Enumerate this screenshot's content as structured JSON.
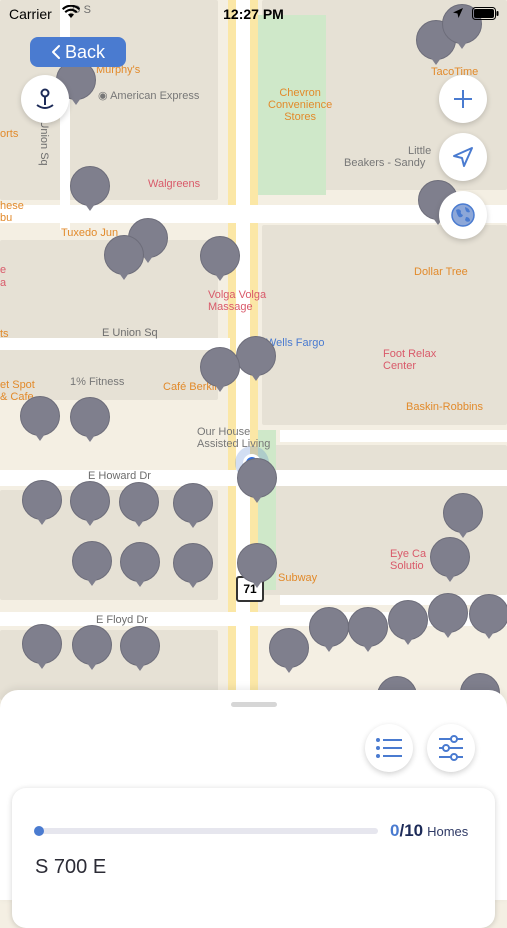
{
  "status_bar": {
    "carrier": "Carrier",
    "time": "12:27 PM"
  },
  "nav": {
    "back_label": "Back"
  },
  "map": {
    "street_labels": [
      "S Union Sq",
      "E Union Sq",
      "E Howard Dr",
      "E Floyd Dr"
    ],
    "pois": {
      "murphys": "Murphy's",
      "american_express": "American Express",
      "walgreens": "Walgreens",
      "tuxedo": "Tuxedo Jun",
      "volga": "Volga Volga\nMassage",
      "fitness": "1% Fitness",
      "cafe": "Café Berkli",
      "wells_fargo": "Wells Fargo",
      "our_house": "Our House\nAssisted Living",
      "chevron": "Chevron\nConvenience\nStores",
      "beakers": "Beakers - Sandy",
      "little": "Little",
      "tacotime": "TacoTime",
      "dollar_tree": "Dollar Tree",
      "foot_relax": "Foot Relax\nCenter",
      "baskin": "Baskin-Robbins",
      "subway": "Subway",
      "eye_care": "Eye Ca\nSolutio",
      "sports": "orts",
      "hese": "hese\nbu",
      "et_spot": "et Spot\n& Cafe",
      "fragment_e": "e",
      "fragment_oa": "a",
      "fragment_ts": "ts",
      "road_num": "71",
      "top_street": "O S"
    }
  },
  "bottom_sheet": {
    "progress": {
      "current": "0",
      "total": "/10",
      "unit": "Homes",
      "fraction": 0.0
    },
    "street_name": "S 700 E"
  },
  "colors": {
    "accent": "#4a7bd0",
    "pin": "#7f7f8d"
  },
  "icons": [
    "location-arrow-icon",
    "battery-icon",
    "wifi-icon",
    "pin-location-icon",
    "plus-icon",
    "navigation-icon",
    "globe-icon",
    "list-icon",
    "filter-icon",
    "chevron-left-icon"
  ]
}
